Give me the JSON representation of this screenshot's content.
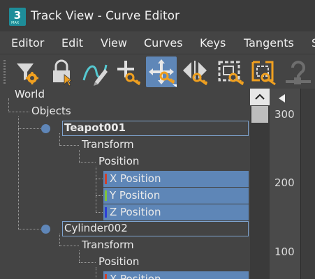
{
  "window": {
    "title": "Track View - Curve Editor",
    "app_icon_text": "3",
    "app_icon_sub": "MAX"
  },
  "menu": [
    {
      "label": "Editor"
    },
    {
      "label": "Edit"
    },
    {
      "label": "View"
    },
    {
      "label": "Curves"
    },
    {
      "label": "Keys"
    },
    {
      "label": "Tangents"
    },
    {
      "label": "S"
    }
  ],
  "toolbar": {
    "tools": [
      {
        "icon": "filter-gear-icon"
      },
      {
        "icon": "lock-selection-icon"
      },
      {
        "icon": "draw-curves-icon"
      },
      {
        "icon": "add-keys-icon"
      },
      {
        "icon": "move-keys-icon",
        "active": true
      },
      {
        "icon": "slide-keys-icon"
      },
      {
        "icon": "scale-keys-icon"
      },
      {
        "icon": "scale-values-icon"
      },
      {
        "icon": "ease-curve-icon"
      }
    ]
  },
  "tree": {
    "world": "World",
    "objects": "Objects",
    "obj1": {
      "name": "Teapot001",
      "transform": "Transform",
      "position": "Position",
      "x": "X Position",
      "y": "Y Position",
      "z": "Z Position"
    },
    "obj2": {
      "name": "Cylinder002",
      "transform": "Transform",
      "position": "Position",
      "x": "X Position"
    }
  },
  "colors": {
    "x_axis": "#d0402a",
    "y_axis": "#7fc43a",
    "z_axis": "#2b3fd6",
    "selection": "#5e86b7"
  },
  "graph": {
    "ticks": [
      "300",
      "200",
      "100"
    ]
  },
  "scrollbar": {
    "up_glyph": "^"
  }
}
